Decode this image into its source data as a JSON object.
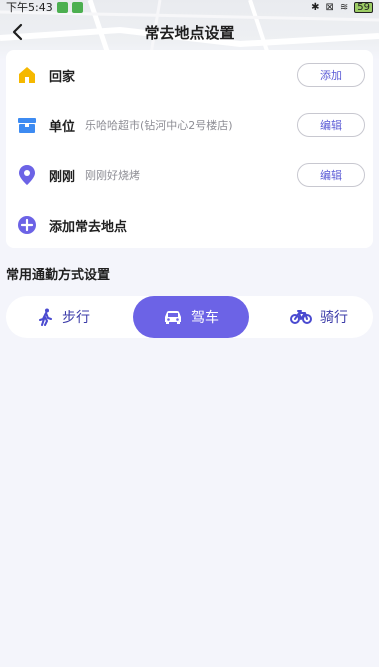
{
  "status_bar": {
    "time": "下午5:43",
    "battery": "59"
  },
  "header": {
    "title": "常去地点设置"
  },
  "places": [
    {
      "name": "回家",
      "address": "",
      "action": "添加",
      "icon": "home-icon",
      "icon_color": "#f5b800"
    },
    {
      "name": "单位",
      "address": "乐哈哈超市(钻河中心2号楼店)",
      "action": "编辑",
      "icon": "briefcase-icon",
      "icon_color": "#3d8bf2"
    },
    {
      "name": "刚刚",
      "address": "刚刚好烧烤",
      "action": "编辑",
      "icon": "location-pin-icon",
      "icon_color": "#6c63e6"
    }
  ],
  "add_place": {
    "label": "添加常去地点",
    "icon": "plus-circle-icon"
  },
  "commute": {
    "title": "常用通勤方式设置",
    "modes": [
      {
        "label": "步行",
        "icon": "walk-icon",
        "selected": false
      },
      {
        "label": "驾车",
        "icon": "car-icon",
        "selected": true
      },
      {
        "label": "骑行",
        "icon": "bicycle-icon",
        "selected": false
      }
    ]
  },
  "colors": {
    "accent": "#6c63e6",
    "background": "#f4f5fb",
    "card": "#ffffff",
    "secondary_text": "#8d8d94"
  }
}
